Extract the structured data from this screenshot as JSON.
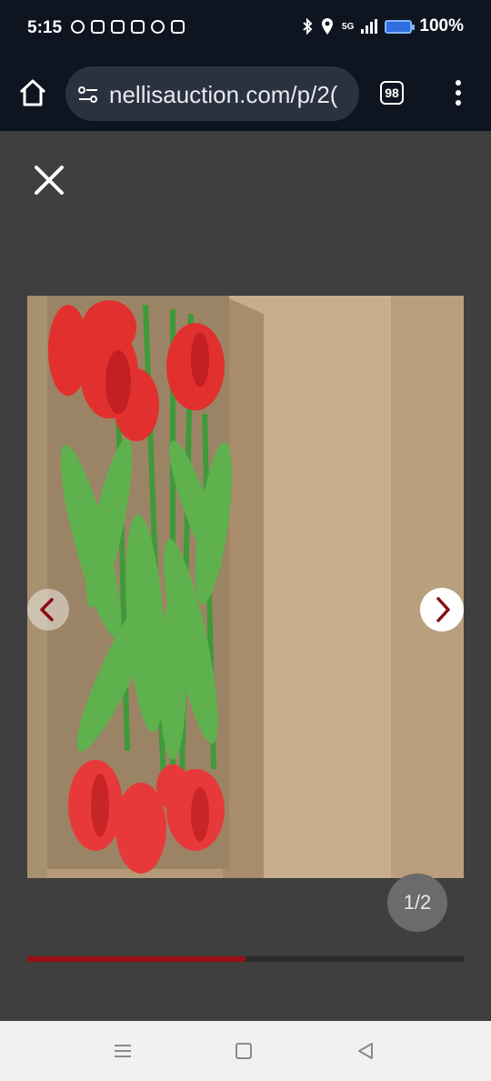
{
  "status_bar": {
    "time": "5:15",
    "network": "5G",
    "battery": "100%",
    "app_icons": [
      "chat-icon",
      "instagram-icon",
      "outlook-icon",
      "gmail-icon",
      "chrome-icon",
      "youtube-icon"
    ]
  },
  "browser": {
    "url": "nellisauction.com/p/2(",
    "tab_count": "98"
  },
  "viewer": {
    "counter": "1/2",
    "progress_fraction": 0.5,
    "progress_color": "#9a0f14",
    "photo_subject": "Artificial red tulips with green stems and leaves in cardboard box"
  },
  "colors": {
    "chrome_bg": "#0f1520",
    "viewer_bg": "#3f3f3f",
    "arrow_red": "#8a0d14"
  }
}
